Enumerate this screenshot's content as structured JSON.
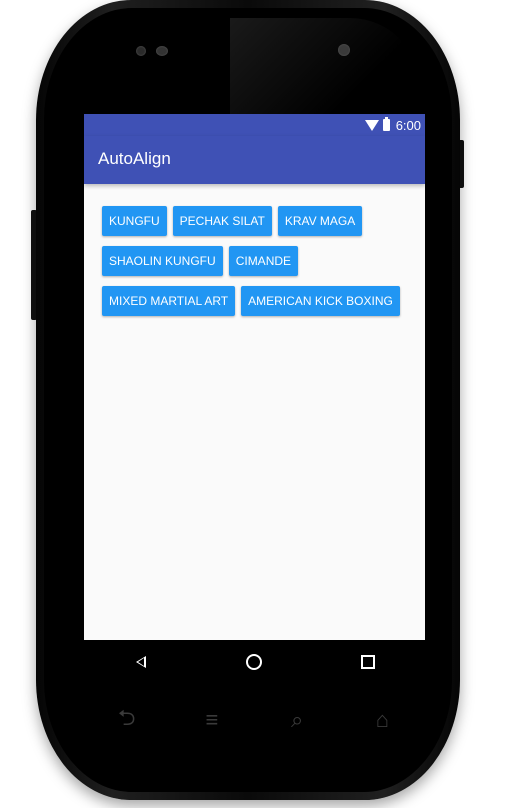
{
  "status_bar": {
    "time": "6:00"
  },
  "app_bar": {
    "title": "AutoAlign"
  },
  "buttons": {
    "row1": [
      "KUNGFU",
      "PECHAK SILAT",
      "KRAV MAGA"
    ],
    "row2": [
      "SHAOLIN KUNGFU",
      "CIMANDE"
    ],
    "row3": [
      "MIXED MARTIAL ART",
      "AMERICAN KICK BOXING"
    ]
  },
  "nav_icons": [
    "back-icon",
    "home-icon",
    "recent-apps-icon"
  ],
  "hardware_keys": [
    "hw-back-icon",
    "hw-menu-icon",
    "hw-search-icon",
    "hw-home-icon"
  ],
  "colors": {
    "primary": "#3f51b5",
    "button": "#2196f3",
    "background": "#fafafa"
  }
}
